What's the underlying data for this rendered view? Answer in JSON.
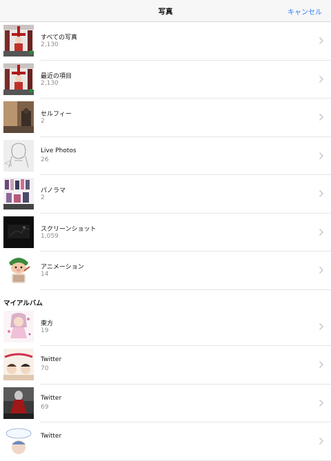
{
  "navbar": {
    "title": "写真",
    "cancel_label": "キャンセル"
  },
  "albums": [
    {
      "title": "すべての写真",
      "count": "2,130",
      "thumb_icon": "cross-figure-thumbnail"
    },
    {
      "title": "最近の項目",
      "count": "2,130",
      "thumb_icon": "cross-figure-thumbnail"
    },
    {
      "title": "セルフィー",
      "count": "2",
      "thumb_icon": "room-photo-thumbnail"
    },
    {
      "title": "Live Photos",
      "count": "26",
      "thumb_icon": "sketch-thumbnail"
    },
    {
      "title": "パノラマ",
      "count": "2",
      "thumb_icon": "collage-thumbnail"
    },
    {
      "title": "スクリーンショット",
      "count": "1,059",
      "thumb_icon": "dark-screenshot-thumbnail"
    },
    {
      "title": "アニメーション",
      "count": "14",
      "thumb_icon": "cartoon-character-thumbnail"
    }
  ],
  "my_albums_header": "マイアルバム",
  "my_albums": [
    {
      "title": "東方",
      "count": "19",
      "thumb_icon": "anime-character-thumbnail"
    },
    {
      "title": "Twitter",
      "count": "70",
      "thumb_icon": "follower-art-thumbnail"
    },
    {
      "title": "Twitter",
      "count": "69",
      "thumb_icon": "red-dress-thumbnail"
    },
    {
      "title": "Twitter",
      "count": "",
      "thumb_icon": "speech-bubble-thumbnail"
    }
  ],
  "colors": {
    "accent": "#2f7cf6",
    "secondary_text": "#8e8e93",
    "separator": "#e5e5e8"
  }
}
